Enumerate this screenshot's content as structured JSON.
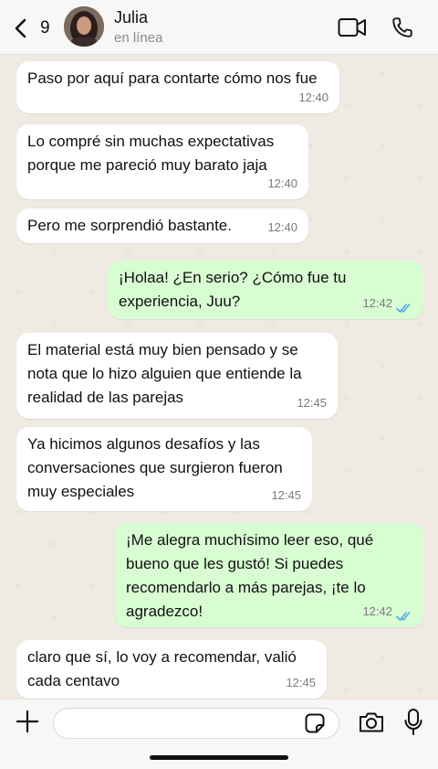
{
  "header": {
    "back_count": "9",
    "contact_name": "Julia",
    "contact_status": "en línea"
  },
  "messages": [
    {
      "direction": "in",
      "text": "Paso por aquí para contarte cómo nos fue",
      "time": "12:40"
    },
    {
      "direction": "in",
      "text": "Lo compré sin muchas expectativas\nporque me pareció muy barato jaja",
      "time": "12:40"
    },
    {
      "direction": "in",
      "text": "Pero me sorprendió bastante.",
      "time": "12:40"
    },
    {
      "direction": "out",
      "text": "¡Holaa! ¿En serio? ¿Cómo fue tu\nexperiencia, Juu?",
      "time": "12:42",
      "status": "read"
    },
    {
      "direction": "in",
      "text": "El material está muy bien pensado y se\nnota que lo hizo alguien que entiende la\nrealidad de las parejas",
      "time": "12:45"
    },
    {
      "direction": "in",
      "text": "Ya hicimos algunos desafíos y las\nconversaciones que surgieron fueron\nmuy especiales",
      "time": "12:45"
    },
    {
      "direction": "out",
      "text": "¡Me alegra muchísimo leer eso, qué\nbueno que les gustó! Si puedes\nrecomendarlo a más parejas, ¡te lo\nagradezco!",
      "time": "12:42",
      "status": "read"
    },
    {
      "direction": "in",
      "text": "claro que sí, lo voy a recomendar, valió\ncada centavo",
      "time": "12:45"
    }
  ],
  "input": {
    "value": "",
    "placeholder": ""
  },
  "colors": {
    "incoming_bubble": "#ffffff",
    "outgoing_bubble": "#d9fdd3",
    "read_ticks": "#4fa8e8",
    "chat_background": "#efeae2"
  },
  "icons": {
    "back": "chevron-left-icon",
    "video": "video-call-icon",
    "phone": "phone-icon",
    "plus": "plus-icon",
    "sticker": "sticker-icon",
    "camera": "camera-icon",
    "mic": "microphone-icon"
  }
}
